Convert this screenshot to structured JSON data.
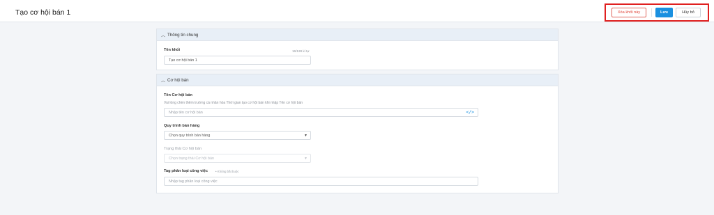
{
  "header": {
    "title": "Tạo cơ hội bán 1",
    "delete_label": "Xóa khối này",
    "save_label": "Lưu",
    "cancel_label": "Hủy bỏ"
  },
  "general": {
    "section_title": "Thông tin chung",
    "block_name_label": "Tên khối",
    "block_name_counter": "16/128 kí tự",
    "block_name_value": "Tạo cơ hội bán 1"
  },
  "opportunity": {
    "section_title": "Cơ hội bán",
    "name_label": "Tên Cơ hội bán",
    "name_hint": "Vui lòng chèn thêm trường cá nhân hóa Thời gian tạo cơ hội bán khi nhập Tên cơ hội bán",
    "name_placeholder": "Nhập tên cơ hội bán",
    "process_label": "Quy trình bán hàng",
    "process_value": "Chọn quy trình bán hàng",
    "status_label": "Trạng thái Cơ hội bán",
    "status_value": "Chọn trạng thái Cơ hội bán",
    "tag_label": "Tag phân loại công việc",
    "tag_optional": "Không bắt buộc",
    "tag_placeholder": "Nhập tag phân loại công việc"
  },
  "icons": {
    "collapse": "chevron-up-icon",
    "dropdown": "caret-down-icon",
    "personalize": "code-icon"
  }
}
